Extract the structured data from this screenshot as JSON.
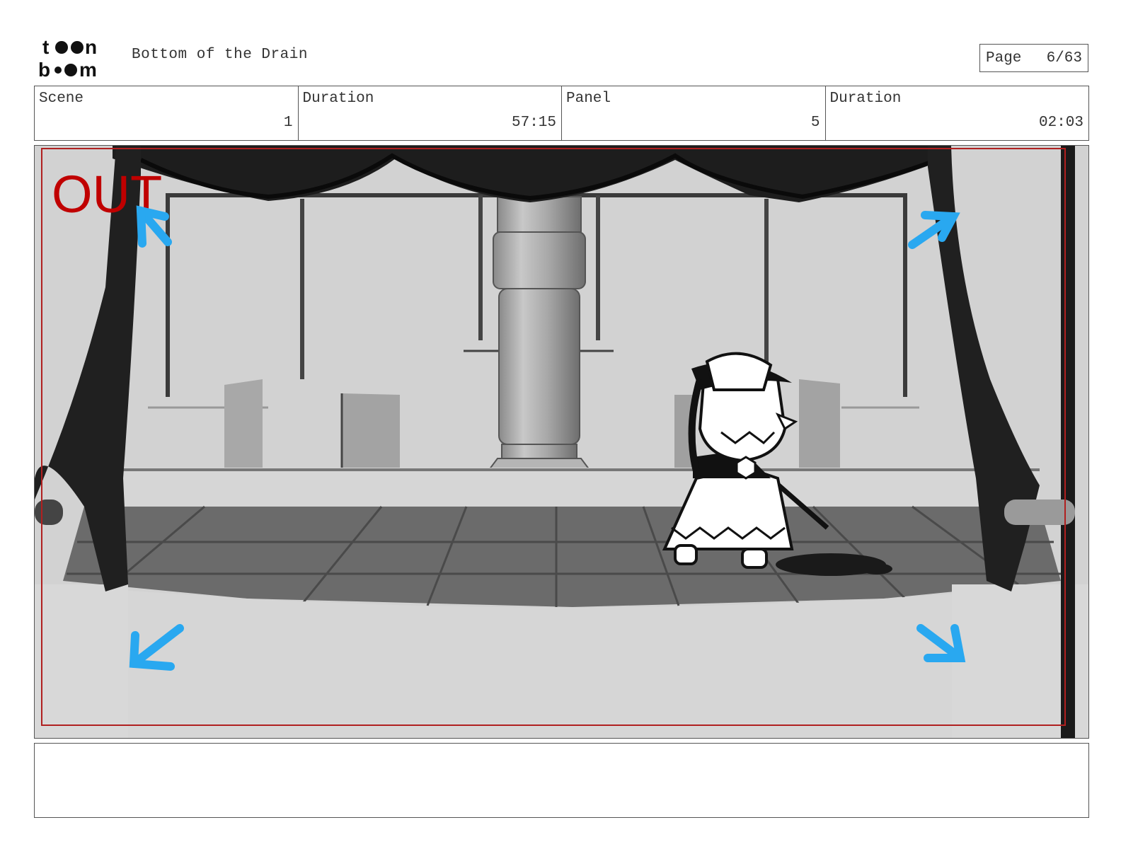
{
  "header": {
    "logo_text_top": "toon",
    "logo_text_bottom": "boom",
    "project_title": "Bottom of the Drain",
    "page_label": "Page",
    "page_value": "6/63"
  },
  "info": {
    "scene_label": "Scene",
    "scene_value": "1",
    "scene_duration_label": "Duration",
    "scene_duration_value": "57:15",
    "panel_label": "Panel",
    "panel_value": "5",
    "panel_duration_label": "Duration",
    "panel_duration_value": "02:03"
  },
  "panel": {
    "camera_annotation": "OUT",
    "annotation_color": "#c00000",
    "arrow_color": "#29a8f0",
    "safe_frame_color": "#b02020"
  },
  "notes": {
    "text": ""
  }
}
